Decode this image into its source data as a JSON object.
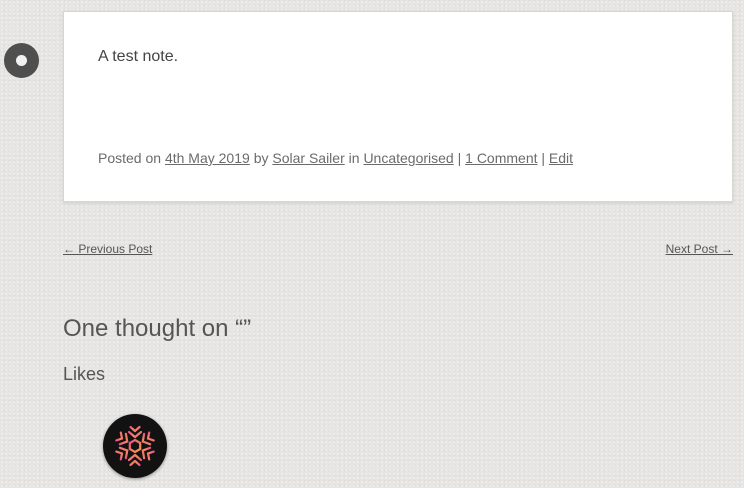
{
  "post": {
    "content": "A test note.",
    "meta": {
      "posted_on_label": "Posted on",
      "date": "4th May 2019",
      "by_label": "by",
      "author": "Solar Sailer",
      "in_label": "in",
      "category": "Uncategorised",
      "separator": "|",
      "comments_link": "1 Comment",
      "edit_link": "Edit"
    }
  },
  "navigation": {
    "previous": "← Previous Post",
    "next": "Next Post →"
  },
  "comments": {
    "title": "One thought on “”"
  },
  "likes": {
    "heading": "Likes"
  },
  "icons": {
    "post_format": "status-marker-icon",
    "liker_avatar": "snowflake-icon"
  },
  "colors": {
    "avatar_gradient_start": "#f0508a",
    "avatar_gradient_end": "#f5a04a"
  }
}
